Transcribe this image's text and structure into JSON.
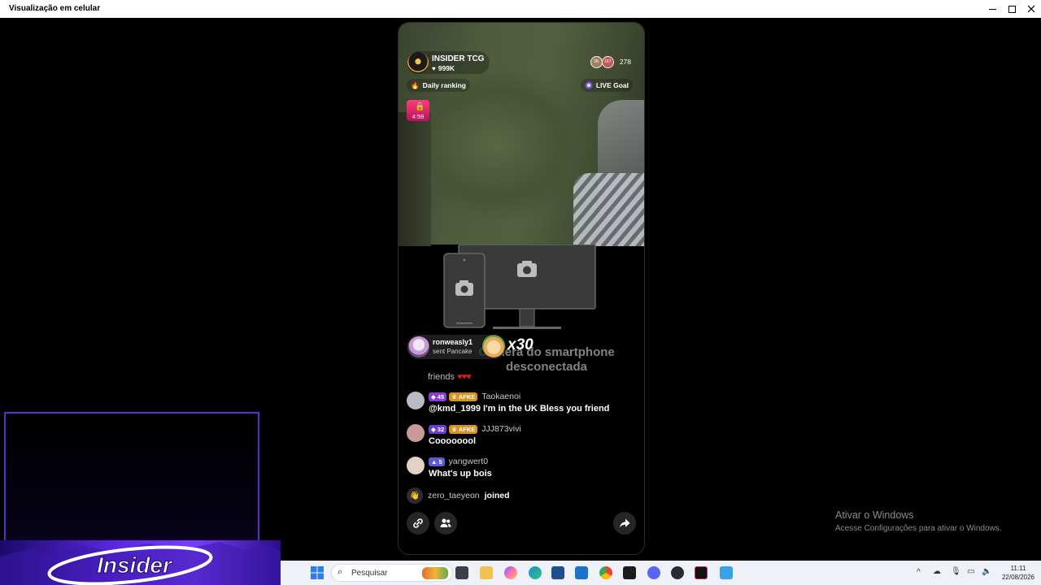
{
  "window": {
    "title": "Visualização em celular"
  },
  "live": {
    "host_name": "INSIDER TCG",
    "host_likes": "999K",
    "viewer_count": "278",
    "viewer_badge_1": "2K",
    "viewer_badge_2": "167",
    "daily_ranking": "Daily ranking",
    "live_goal": "LIVE Goal",
    "gift_timer": "4:59",
    "disconnected_text_1": "Câmera do smartphone",
    "disconnected_text_2": "desconectada",
    "gift_notification": {
      "user": "ronweasly1",
      "subtitle": "sent Pancake",
      "count": "x30"
    },
    "partial_comment": "friends",
    "comments": [
      {
        "level": "45",
        "level_color": "#8c3bd6",
        "badge": "AFKE",
        "user": "Taokaenoi",
        "text": "@kmd_1999 I'm in the UK Bless you friend",
        "avatar_color": "#b8bcc4"
      },
      {
        "level": "32",
        "level_color": "#8c3bd6",
        "badge": "AFKE",
        "user": "JJJ873vivi",
        "text": "Coooooool",
        "avatar_color": "#c89a9a"
      },
      {
        "level": "5",
        "level_color": "#5b5bd6",
        "badge": "",
        "user": "yangwert0",
        "text": "What's up bois",
        "avatar_color": "#e2d2c6"
      }
    ],
    "joined": {
      "user": "zero_taeyeon",
      "text": "joined"
    }
  },
  "overlay": {
    "brand": "Insider"
  },
  "watermark": {
    "line1": "Ativar o Windows",
    "line2": "Acesse Configurações para ativar o Windows."
  },
  "taskbar": {
    "search_placeholder": "Pesquisar",
    "time": "11:11",
    "date": "22/08/2026"
  },
  "colors": {
    "accent_purple": "#5c2bd8",
    "taskbar_bg": "#eef1f7"
  }
}
